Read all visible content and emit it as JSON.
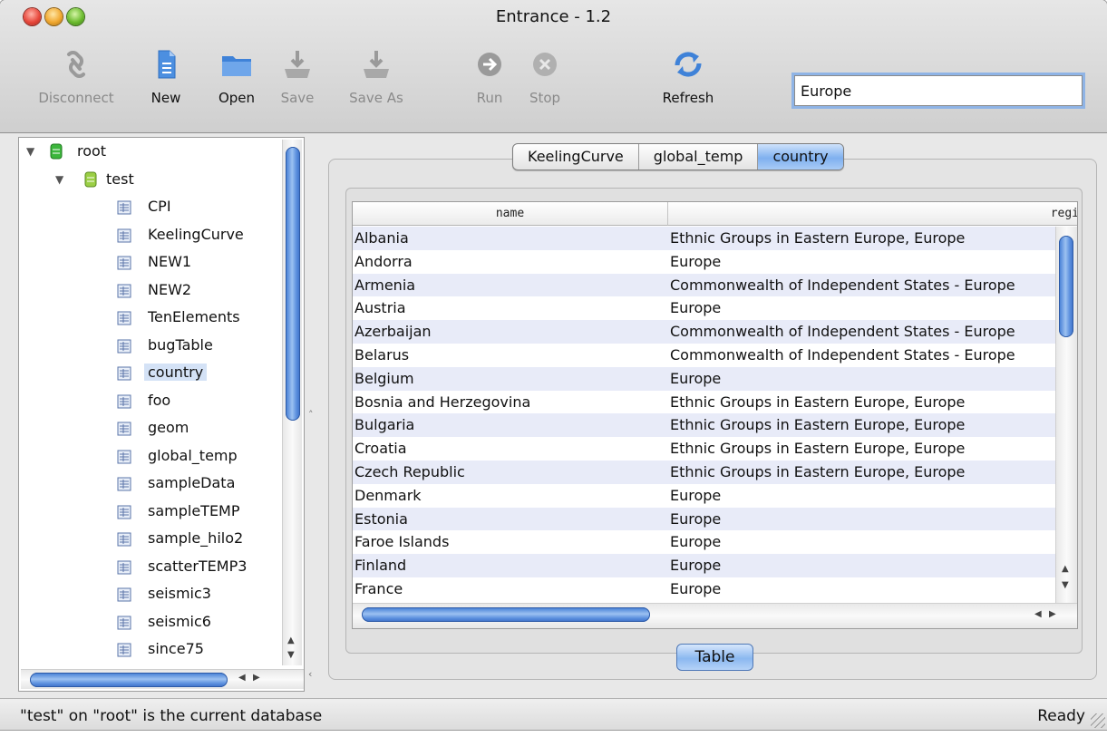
{
  "window": {
    "title": "Entrance - 1.2"
  },
  "toolbar": {
    "items": [
      {
        "label": "Disconnect",
        "icon": "link-icon",
        "enabled": false
      },
      {
        "label": "New",
        "icon": "new-document-icon",
        "enabled": true
      },
      {
        "label": "Open",
        "icon": "folder-icon",
        "enabled": true
      },
      {
        "label": "Save",
        "icon": "save-icon",
        "enabled": false
      },
      {
        "label": "Save As",
        "icon": "save-as-icon",
        "enabled": false
      },
      {
        "label": "Run",
        "icon": "run-arrow-icon",
        "enabled": false
      },
      {
        "label": "Stop",
        "icon": "stop-icon",
        "enabled": false
      },
      {
        "label": "Refresh",
        "icon": "refresh-icon",
        "enabled": true
      }
    ],
    "search_value": "Europe"
  },
  "tree": {
    "root": "root",
    "database": "test",
    "tables": [
      "CPI",
      "KeelingCurve",
      "NEW1",
      "NEW2",
      "TenElements",
      "bugTable",
      "country",
      "foo",
      "geom",
      "global_temp",
      "sampleData",
      "sampleTEMP",
      "sample_hilo2",
      "scatterTEMP3",
      "seismic3",
      "seismic6",
      "since75"
    ],
    "selected": "country"
  },
  "tabs": [
    "KeelingCurve",
    "global_temp",
    "country"
  ],
  "active_tab": "country",
  "table": {
    "columns": [
      "name",
      "regi"
    ],
    "rows": [
      [
        "Albania",
        "Ethnic Groups in Eastern Europe,  Europe"
      ],
      [
        "Andorra",
        "Europe"
      ],
      [
        "Armenia",
        "Commonwealth of Independent States - Europe"
      ],
      [
        "Austria",
        "Europe"
      ],
      [
        "Azerbaijan",
        "Commonwealth of Independent States - Europe"
      ],
      [
        "Belarus",
        "Commonwealth of Independent States - Europe"
      ],
      [
        "Belgium",
        "Europe"
      ],
      [
        "Bosnia and Herzegovina",
        "Ethnic Groups in Eastern Europe,  Europe"
      ],
      [
        "Bulgaria",
        "Ethnic Groups in Eastern Europe,  Europe"
      ],
      [
        "Croatia",
        "Ethnic Groups in Eastern Europe,  Europe"
      ],
      [
        "Czech Republic",
        "Ethnic Groups in Eastern Europe,  Europe"
      ],
      [
        "Denmark",
        "Europe"
      ],
      [
        "Estonia",
        "Europe"
      ],
      [
        "Faroe Islands",
        "Europe"
      ],
      [
        "Finland",
        "Europe"
      ],
      [
        "France",
        "Europe"
      ]
    ]
  },
  "view_button": "Table",
  "status": {
    "message": "\"test\" on \"root\" is the current database",
    "state": "Ready"
  }
}
